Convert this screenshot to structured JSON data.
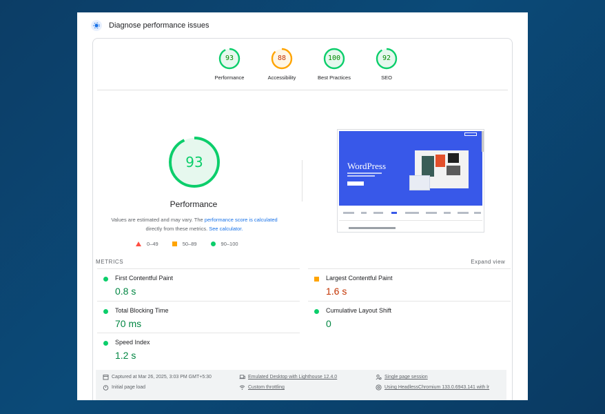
{
  "header": {
    "title": "Diagnose performance issues"
  },
  "scores": [
    {
      "value": "93",
      "label": "Performance",
      "color": "#0cce6b",
      "fraction": 0.93
    },
    {
      "value": "88",
      "label": "Accessibility",
      "color": "#ffa400",
      "fraction": 0.88
    },
    {
      "value": "100",
      "label": "Best Practices",
      "color": "#0cce6b",
      "fraction": 1.0
    },
    {
      "value": "92",
      "label": "SEO",
      "color": "#0cce6b",
      "fraction": 0.92
    }
  ],
  "main": {
    "score": "93",
    "score_fraction": 0.93,
    "title": "Performance",
    "note_pre": "Values are estimated and may vary. The ",
    "note_link1": "performance score is calculated",
    "note_mid": "directly from these metrics. ",
    "note_link2": "See calculator.",
    "legend": [
      {
        "label": "0–49",
        "color": "#ff4e42"
      },
      {
        "label": "50–89",
        "color": "#ffa400"
      },
      {
        "label": "90–100",
        "color": "#0cce6b"
      }
    ]
  },
  "preview": {
    "brand": "WordPress"
  },
  "metrics": {
    "heading": "METRICS",
    "expand": "Expand view",
    "items": [
      {
        "name": "First Contentful Paint",
        "value": "0.8 s",
        "status": "good"
      },
      {
        "name": "Largest Contentful Paint",
        "value": "1.6 s",
        "status": "average"
      },
      {
        "name": "Total Blocking Time",
        "value": "70 ms",
        "status": "good"
      },
      {
        "name": "Cumulative Layout Shift",
        "value": "0",
        "status": "good"
      },
      {
        "name": "Speed Index",
        "value": "1.2 s",
        "status": "good"
      }
    ]
  },
  "footer": {
    "captured": "Captured at Mar 26, 2025, 3:03 PM GMT+5:30",
    "load": "Initial page load",
    "device": "Emulated Desktop with Lighthouse 12.4.0",
    "throttling": "Custom throttling",
    "session": "Single page session",
    "browser": "Using HeadlessChromium 133.0.6943.141 with lr"
  }
}
